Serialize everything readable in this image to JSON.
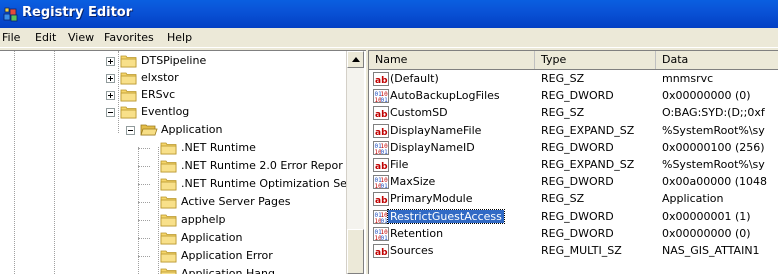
{
  "window": {
    "title": "Registry Editor",
    "icon": "registry-cubes-icon"
  },
  "menu": [
    "File",
    "Edit",
    "View",
    "Favorites",
    "Help"
  ],
  "tree": {
    "items": [
      {
        "label": "DTSPipeline",
        "expander": "plus"
      },
      {
        "label": "elxstor",
        "expander": "plus"
      },
      {
        "label": "ERSvc",
        "expander": "plus"
      },
      {
        "label": "Eventlog",
        "expander": "minus"
      },
      {
        "label": "Application",
        "expander": "minus",
        "open": true
      },
      {
        "label": ".NET Runtime"
      },
      {
        "label": ".NET Runtime 2.0 Error Repor"
      },
      {
        "label": ".NET Runtime Optimization Ser"
      },
      {
        "label": "Active Server Pages"
      },
      {
        "label": "apphelp"
      },
      {
        "label": "Application"
      },
      {
        "label": "Application Error"
      },
      {
        "label": "Application Hang"
      }
    ]
  },
  "list": {
    "columns": [
      "Name",
      "Type",
      "Data"
    ],
    "selected_index": 8,
    "rows": [
      {
        "icon": "string-value-icon",
        "name": "(Default)",
        "type": "REG_SZ",
        "data": "mnmsrvc"
      },
      {
        "icon": "binary-value-icon",
        "name": "AutoBackupLogFiles",
        "type": "REG_DWORD",
        "data": "0x00000000 (0)"
      },
      {
        "icon": "string-value-icon",
        "name": "CustomSD",
        "type": "REG_SZ",
        "data": "O:BAG:SYD:(D;;0xf"
      },
      {
        "icon": "string-value-icon",
        "name": "DisplayNameFile",
        "type": "REG_EXPAND_SZ",
        "data": "%SystemRoot%\\sy"
      },
      {
        "icon": "binary-value-icon",
        "name": "DisplayNameID",
        "type": "REG_DWORD",
        "data": "0x00000100 (256)"
      },
      {
        "icon": "string-value-icon",
        "name": "File",
        "type": "REG_EXPAND_SZ",
        "data": "%SystemRoot%\\sy"
      },
      {
        "icon": "binary-value-icon",
        "name": "MaxSize",
        "type": "REG_DWORD",
        "data": "0x00a00000 (1048"
      },
      {
        "icon": "string-value-icon",
        "name": "PrimaryModule",
        "type": "REG_SZ",
        "data": "Application"
      },
      {
        "icon": "binary-value-icon",
        "name": "RestrictGuestAccess",
        "type": "REG_DWORD",
        "data": "0x00000001 (1)"
      },
      {
        "icon": "binary-value-icon",
        "name": "Retention",
        "type": "REG_DWORD",
        "data": "0x00000000 (0)"
      },
      {
        "icon": "string-value-icon",
        "name": "Sources",
        "type": "REG_MULTI_SZ",
        "data": "NAS_GIS_ATTAIN1"
      }
    ]
  },
  "colors": {
    "titlebar": "#0a54d8",
    "selection": "#316ac5",
    "folder": "#f5d56b"
  }
}
